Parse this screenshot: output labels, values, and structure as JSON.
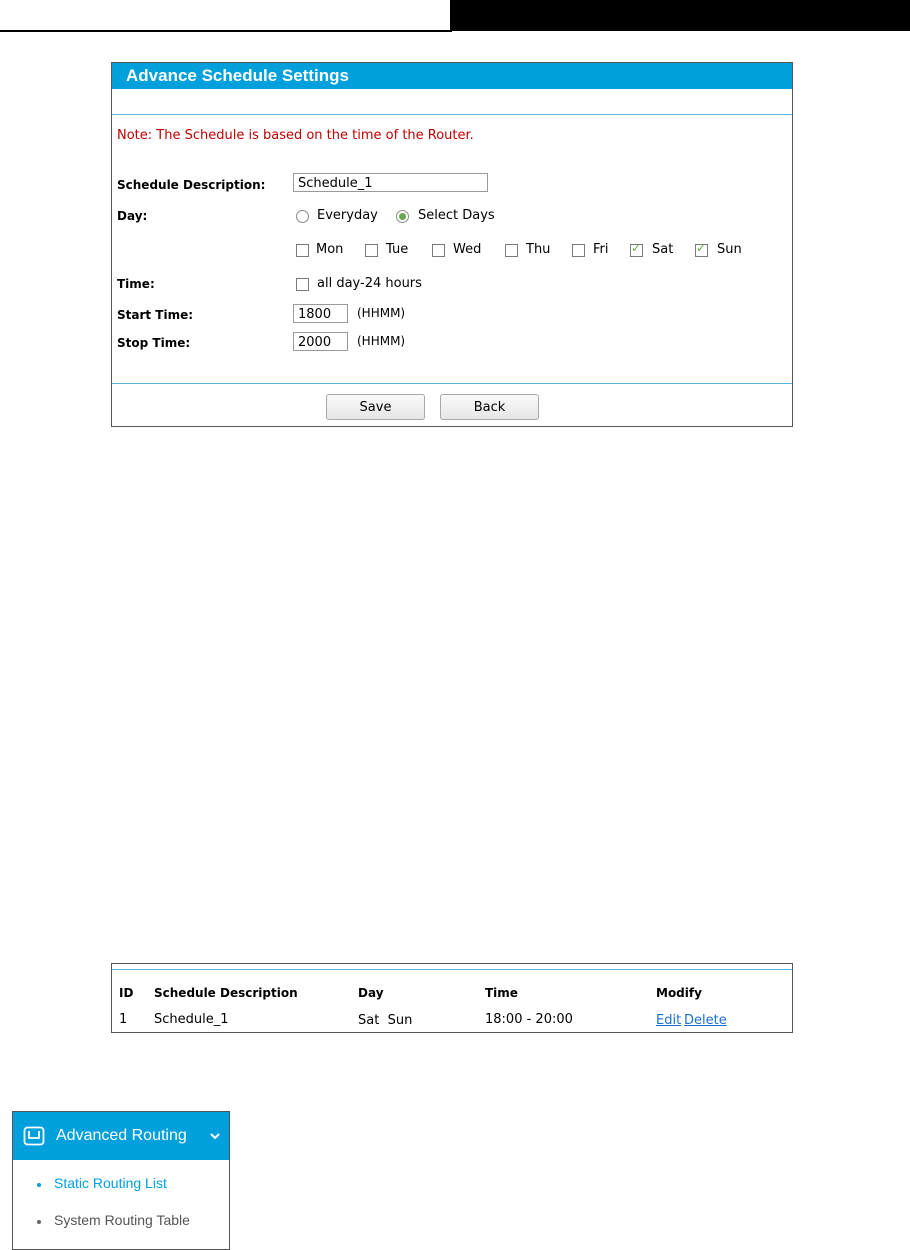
{
  "panel": {
    "title": "Advance Schedule Settings",
    "note": "Note: The Schedule is based on the time of the Router.",
    "schedule_description_label": "Schedule Description:",
    "schedule_description_value": "Schedule_1",
    "day_label": "Day:",
    "day_options": [
      {
        "label": "Everyday",
        "selected": false
      },
      {
        "label": "Select Days",
        "selected": true
      }
    ],
    "days": [
      {
        "label": "Mon",
        "checked": false
      },
      {
        "label": "Tue",
        "checked": false
      },
      {
        "label": "Wed",
        "checked": false
      },
      {
        "label": "Thu",
        "checked": false
      },
      {
        "label": "Fri",
        "checked": false
      },
      {
        "label": "Sat",
        "checked": true
      },
      {
        "label": "Sun",
        "checked": true
      }
    ],
    "time_label": "Time:",
    "all_day_label": "all day-24 hours",
    "all_day_checked": false,
    "start_time_label": "Start Time:",
    "start_time_value": "1800",
    "stop_time_label": "Stop Time:",
    "stop_time_value": "2000",
    "format_hint": "(HHMM)",
    "save_label": "Save",
    "back_label": "Back",
    "accent_color": "#00a0dc",
    "note_color": "#c00000"
  },
  "table": {
    "headers": [
      "ID",
      "Schedule Description",
      "Day",
      "Time",
      "Modify"
    ],
    "rows": [
      {
        "id": "1",
        "description": "Schedule_1",
        "day": "Sat  Sun",
        "time": "18:00 - 20:00",
        "edit": "Edit",
        "delete": "Delete"
      }
    ]
  },
  "nav": {
    "title": "Advanced Routing",
    "icon": "router-icon",
    "items": [
      {
        "label": "Static Routing List",
        "active": true
      },
      {
        "label": "System Routing Table",
        "active": false
      }
    ]
  }
}
